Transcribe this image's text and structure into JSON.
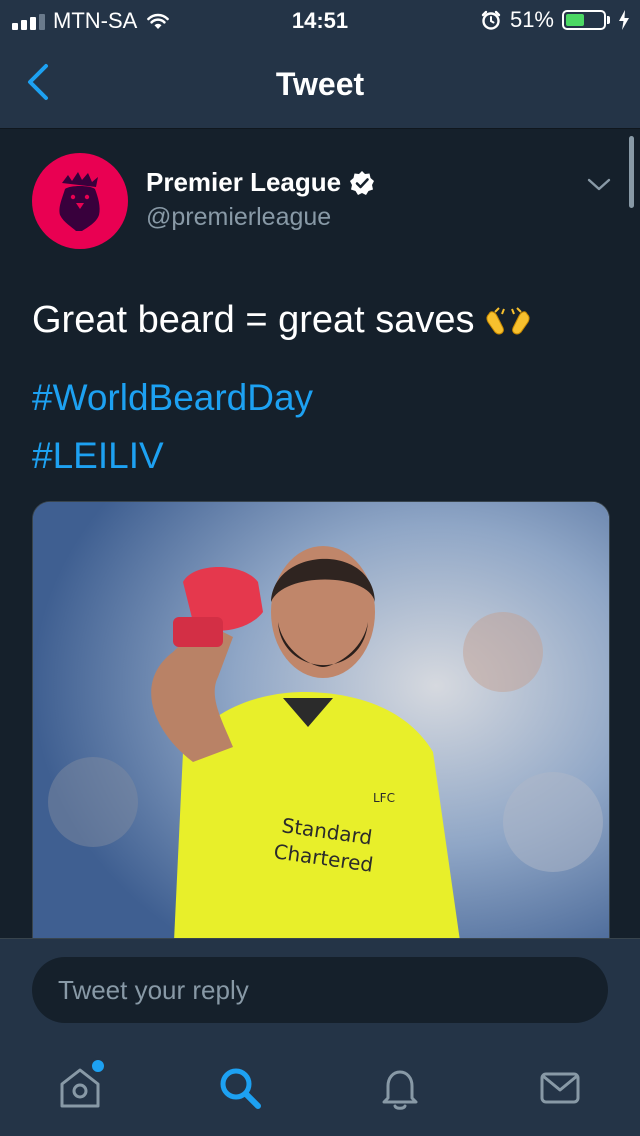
{
  "status_bar": {
    "carrier": "MTN-SA",
    "time": "14:51",
    "battery_percent": "51%",
    "battery_level": 0.51,
    "icons": [
      "signal-icon",
      "wifi-icon",
      "alarm-icon",
      "battery-icon",
      "charging-icon"
    ]
  },
  "nav": {
    "title": "Tweet",
    "back_icon": "chevron-left-icon"
  },
  "tweet": {
    "author_name": "Premier League",
    "verified": true,
    "handle": "@premierleague",
    "text": "Great beard = great saves",
    "emoji": "raising-hands-emoji",
    "hashtags": [
      "#WorldBeardDay",
      "#LEILIV"
    ],
    "media": {
      "kind": "photo",
      "print": [
        "LFC",
        "Standard",
        "Chartered"
      ]
    }
  },
  "reply": {
    "placeholder": "Tweet your reply"
  },
  "tab_bar": {
    "items": [
      "home-icon",
      "search-icon",
      "notifications-icon",
      "messages-icon"
    ],
    "active": "search-icon",
    "home_has_new": true
  },
  "colors": {
    "background": "#15202b",
    "bar": "#243447",
    "accent": "#1da1f2",
    "secondary_text": "#8899a6",
    "avatar": "#e90052"
  }
}
